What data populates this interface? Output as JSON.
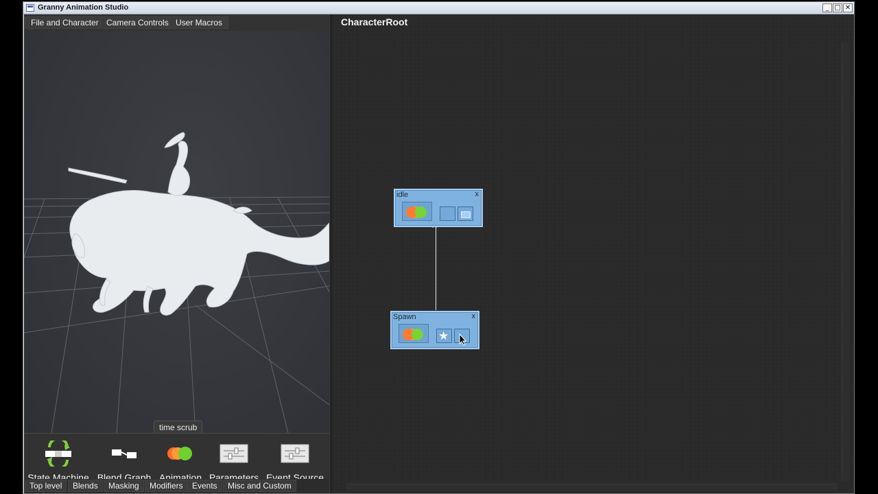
{
  "window": {
    "title": "Granny Animation Studio",
    "controls": {
      "minimize": "_",
      "maximize": "□",
      "close": "✕"
    }
  },
  "left_panel": {
    "top_tabs": [
      "File and Character",
      "Camera Controls",
      "User Macros"
    ],
    "viewport": {
      "time_scrub_label": "time scrub"
    },
    "toolbox": [
      {
        "label": "State Machine",
        "icon": "state-machine-icon"
      },
      {
        "label": "Blend Graph",
        "icon": "blend-graph-icon"
      },
      {
        "label": "Animation",
        "icon": "animation-icon"
      },
      {
        "label": "Parameters",
        "icon": "parameters-icon"
      },
      {
        "label": "Event Source",
        "icon": "event-source-icon"
      }
    ],
    "bottom_tabs": [
      "Top level",
      "Blends",
      "Masking",
      "Modifiers",
      "Events",
      "Misc and Custom"
    ]
  },
  "graph_panel": {
    "title": "CharacterRoot",
    "nodes": [
      {
        "title": "idle",
        "close": "x"
      },
      {
        "title": "Spawn",
        "close": "x"
      }
    ]
  },
  "colors": {
    "node_fill": "#7fb2df",
    "panel_bg": "#2a2a2a",
    "animation_orange": "#ff7a33",
    "animation_green": "#77d436"
  }
}
